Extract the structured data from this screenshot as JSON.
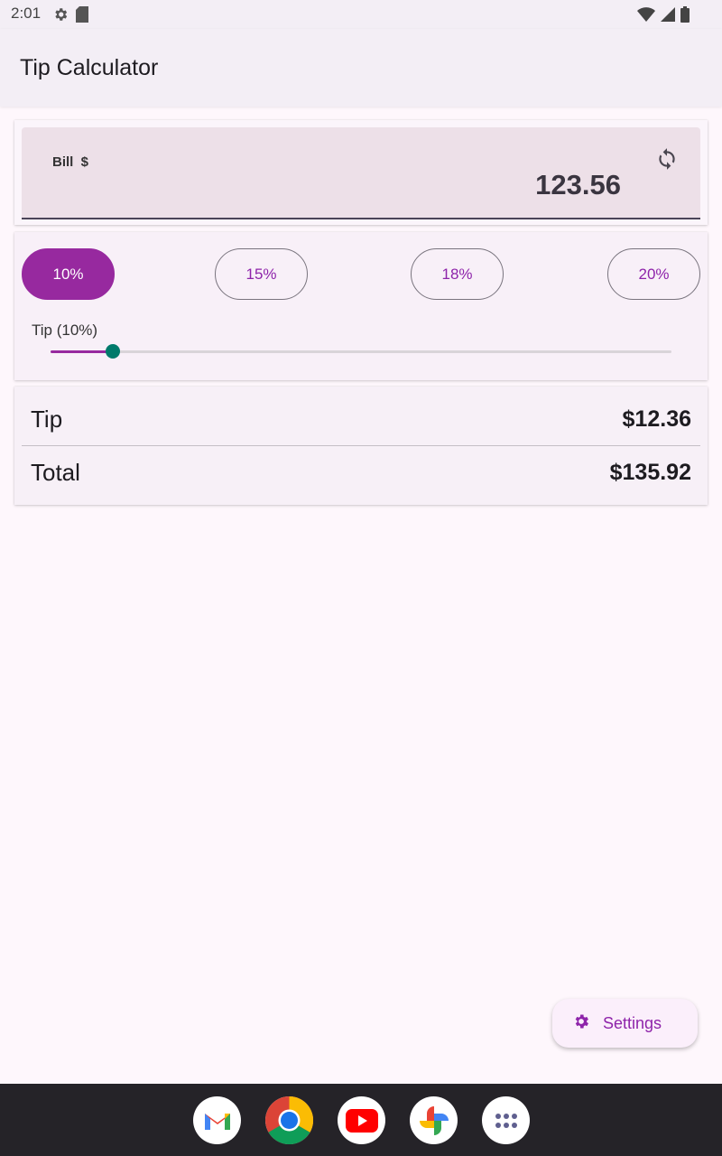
{
  "status_bar": {
    "time": "2:01",
    "left_icons": [
      "settings-gear-icon",
      "sd-card-icon"
    ],
    "right_icons": [
      "wifi-icon",
      "cellular-signal-icon",
      "battery-icon"
    ]
  },
  "app_bar": {
    "title": "Tip Calculator"
  },
  "bill": {
    "label": "Bill  $",
    "value": "123.56",
    "action_icon": "refresh-icon"
  },
  "tip_options": {
    "chips": [
      {
        "label": "10%",
        "selected": true
      },
      {
        "label": "15%",
        "selected": false
      },
      {
        "label": "18%",
        "selected": false
      },
      {
        "label": "20%",
        "selected": false
      }
    ],
    "slider_label": "Tip (10%)",
    "slider_value_fraction": 0.1
  },
  "results": {
    "tip_label": "Tip",
    "tip_value": "$12.36",
    "total_label": "Total",
    "total_value": "$135.92"
  },
  "fab": {
    "label": "Settings",
    "icon": "gear-icon"
  },
  "dock": {
    "apps": [
      "gmail-icon",
      "chrome-icon",
      "youtube-icon",
      "photos-icon",
      "app-drawer-icon"
    ]
  },
  "colors": {
    "accent": "#97299f",
    "accent_text": "#8e24aa",
    "slider_thumb": "#007a6b",
    "background": "#fef7fc"
  }
}
